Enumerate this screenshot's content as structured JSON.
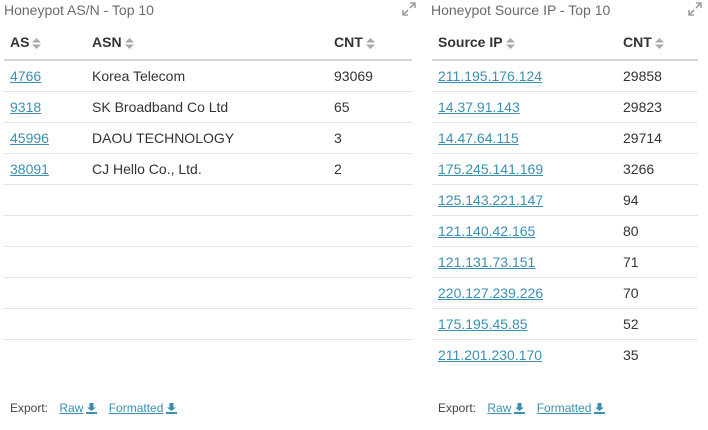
{
  "asn_panel": {
    "title": "Honeypot AS/N - Top 10",
    "columns": [
      "AS",
      "ASN",
      "CNT"
    ],
    "rows": [
      {
        "as": "4766",
        "asn": "Korea Telecom",
        "cnt": "93069"
      },
      {
        "as": "9318",
        "asn": "SK Broadband Co Ltd",
        "cnt": "65"
      },
      {
        "as": "45996",
        "asn": "DAOU TECHNOLOGY",
        "cnt": "3"
      },
      {
        "as": "38091",
        "asn": "CJ Hello Co., Ltd.",
        "cnt": "2"
      }
    ],
    "export": {
      "label": "Export:",
      "raw": "Raw",
      "formatted": "Formatted"
    }
  },
  "ip_panel": {
    "title": "Honeypot Source IP - Top 10",
    "columns": [
      "Source IP",
      "CNT"
    ],
    "rows": [
      {
        "ip": "211.195.176.124",
        "cnt": "29858"
      },
      {
        "ip": "14.37.91.143",
        "cnt": "29823"
      },
      {
        "ip": "14.47.64.115",
        "cnt": "29714"
      },
      {
        "ip": "175.245.141.169",
        "cnt": "3266"
      },
      {
        "ip": "125.143.221.147",
        "cnt": "94"
      },
      {
        "ip": "121.140.42.165",
        "cnt": "80"
      },
      {
        "ip": "121.131.73.151",
        "cnt": "71"
      },
      {
        "ip": "220.127.239.226",
        "cnt": "70"
      },
      {
        "ip": "175.195.45.85",
        "cnt": "52"
      },
      {
        "ip": "211.201.230.170",
        "cnt": "35"
      }
    ],
    "export": {
      "label": "Export:",
      "raw": "Raw",
      "formatted": "Formatted"
    }
  },
  "colors": {
    "link": "#3b8fb2",
    "title": "#6b6b6b",
    "icon": "#999999",
    "border": "#e4e4e4"
  },
  "icons": {
    "expand": "expand-icon",
    "sort": "sort-icon",
    "download": "download-icon"
  }
}
